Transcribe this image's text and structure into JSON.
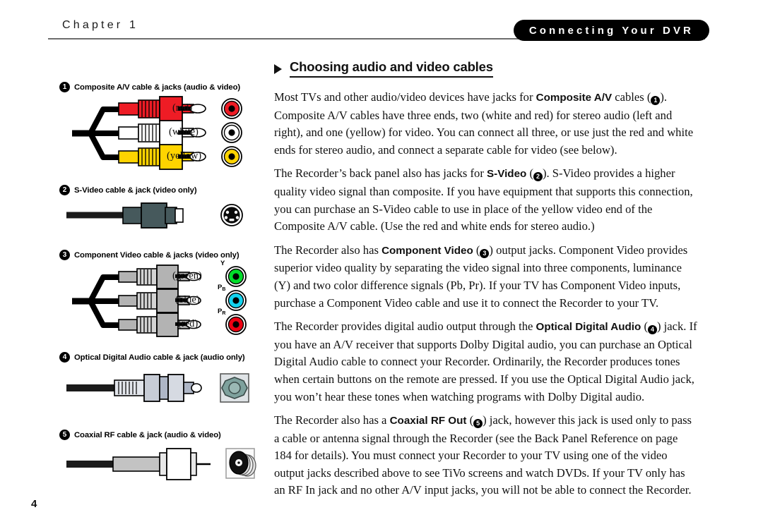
{
  "header": {
    "chapter": "Chapter 1",
    "section_pill": "Connecting Your DVR"
  },
  "section": {
    "heading": "Choosing audio and video cables"
  },
  "figures": [
    {
      "number": "1",
      "caption": "Composite A/V cable & jacks (audio & video)",
      "type": "composite-av",
      "connectors": [
        {
          "label": "(red)",
          "color": "#ee1c25"
        },
        {
          "label": "(white)",
          "color": "#ffffff"
        },
        {
          "label": "(yellow)",
          "color": "#ffd400"
        }
      ],
      "jacks": [
        {
          "tag": "",
          "color": "#ee1c25"
        },
        {
          "tag": "",
          "color": "#ffffff"
        },
        {
          "tag": "",
          "color": "#ffd400"
        }
      ]
    },
    {
      "number": "2",
      "caption": "S-Video cable & jack (video only)",
      "type": "s-video",
      "connector_color": "#46595c",
      "jack_color": "#000000"
    },
    {
      "number": "3",
      "caption": "Component Video cable & jacks (video only)",
      "type": "component-video",
      "connectors": [
        {
          "label": "(green)",
          "color": "#b3b3b3"
        },
        {
          "label": "(blue)",
          "color": "#b3b3b3"
        },
        {
          "label": "(red)",
          "color": "#b3b3b3"
        }
      ],
      "jacks": [
        {
          "tag": "Y",
          "tag_sub": "",
          "color": "#00dd2a"
        },
        {
          "tag": "P",
          "tag_sub": "B",
          "color": "#13d3ef"
        },
        {
          "tag": "P",
          "tag_sub": "R",
          "color": "#ee0012"
        }
      ]
    },
    {
      "number": "4",
      "caption": "Optical Digital Audio cable & jack (audio only)",
      "type": "optical-digital-audio",
      "connector_color": "#c7ccd6",
      "jack_color": "#7ea19d"
    },
    {
      "number": "5",
      "caption": "Coaxial RF cable & jack (audio & video)",
      "type": "coaxial-rf",
      "connector_color": "#c3c3c3",
      "jack_color": "#111111"
    }
  ],
  "paragraphs": [
    {
      "id": "p-composite",
      "parts": [
        {
          "t": "text",
          "v": "Most TVs and other audio/video devices have jacks for "
        },
        {
          "t": "bold",
          "v": "Composite A/V"
        },
        {
          "t": "text",
          "v": " cables ("
        },
        {
          "t": "badge",
          "v": "1"
        },
        {
          "t": "text",
          "v": "). Composite A/V cables have three ends, two (white and red) for stereo audio (left and right), and one (yellow) for video. You can connect all three, or use just the red and white ends for stereo audio, and connect a separate cable for video (see below)."
        }
      ]
    },
    {
      "id": "p-svideo",
      "parts": [
        {
          "t": "text",
          "v": "The Recorder’s back panel also has jacks for "
        },
        {
          "t": "bold",
          "v": "S-Video"
        },
        {
          "t": "text",
          "v": " ("
        },
        {
          "t": "badge",
          "v": "2"
        },
        {
          "t": "text",
          "v": "). S-Video provides a higher quality video signal than composite. If you have equipment that supports this connection, you can purchase an S-Video cable to use in place of the yellow video end of the Composite A/V cable. (Use the red and white ends for stereo audio.)"
        }
      ]
    },
    {
      "id": "p-component",
      "parts": [
        {
          "t": "text",
          "v": "The Recorder also has "
        },
        {
          "t": "bold",
          "v": "Component Video"
        },
        {
          "t": "text",
          "v": " ("
        },
        {
          "t": "badge",
          "v": "3"
        },
        {
          "t": "text",
          "v": ") output jacks. Component Video provides superior video quality by separating the video signal into three components, luminance (Y) and two color difference signals (Pb, Pr). If your TV has Component Video inputs, purchase a Component Video cable and use it to connect the Recorder to your TV."
        }
      ]
    },
    {
      "id": "p-optical",
      "parts": [
        {
          "t": "text",
          "v": "The Recorder provides digital audio output through the "
        },
        {
          "t": "bold",
          "v": "Optical Digital Audio"
        },
        {
          "t": "text",
          "v": " ("
        },
        {
          "t": "badge",
          "v": "4"
        },
        {
          "t": "text",
          "v": ") jack. If you have an A/V receiver that supports Dolby Digital audio, you can purchase an Optical Digital Audio cable to connect your Recorder. Ordinarily, the Recorder produces tones when certain buttons on the remote are pressed. If you use the Optical Digital Audio jack, you won’t hear these tones when watching programs with Dolby Digital audio."
        }
      ]
    },
    {
      "id": "p-coax",
      "parts": [
        {
          "t": "text",
          "v": "The Recorder also has a "
        },
        {
          "t": "bold",
          "v": "Coaxial RF Out"
        },
        {
          "t": "text",
          "v": " ("
        },
        {
          "t": "badge",
          "v": "5"
        },
        {
          "t": "text",
          "v": ") jack, however this jack is used only to pass a cable or antenna signal through the Recorder (see the Back Panel Reference on page 184 for details). You must connect your Recorder to your TV using one of the video output jacks described above to see TiVo screens and watch DVDs. If your TV only has an RF In jack and no other A/V input jacks, you will not be able to connect the Recorder."
        }
      ]
    }
  ],
  "footer": {
    "page_number": "4"
  }
}
